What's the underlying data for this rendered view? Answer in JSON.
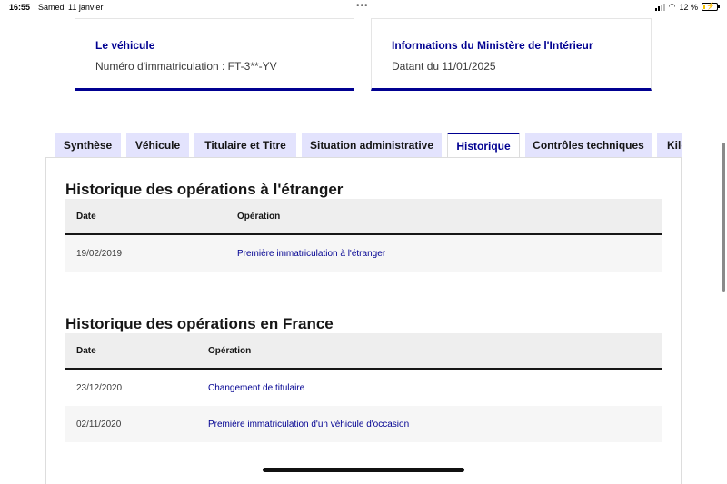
{
  "status_bar": {
    "time": "16:55",
    "date": "Samedi 11 janvier",
    "battery": "12 %",
    "battery_level": 0.12
  },
  "cards": [
    {
      "title": "Le véhicule",
      "text": "Numéro d'immatriculation : FT-3**-YV"
    },
    {
      "title": "Informations du Ministère de l'Intérieur",
      "text": "Datant du 11/01/2025"
    }
  ],
  "tabs": [
    {
      "label": "Synthèse"
    },
    {
      "label": "Véhicule"
    },
    {
      "label": "Titulaire et Titre"
    },
    {
      "label": "Situation administrative"
    },
    {
      "label": "Historique",
      "active": true
    },
    {
      "label": "Contrôles techniques"
    },
    {
      "label": "Kilo"
    }
  ],
  "sections": [
    {
      "title": "Historique des opérations à l'étranger",
      "headers": [
        "Date",
        "Opération"
      ],
      "rows": [
        {
          "date": "19/02/2019",
          "operation": "Première immatriculation à l'étranger"
        }
      ]
    },
    {
      "title": "Historique des opérations en France",
      "headers": [
        "Date",
        "Opération"
      ],
      "rows": [
        {
          "date": "23/12/2020",
          "operation": "Changement de titulaire"
        },
        {
          "date": "02/11/2020",
          "operation": "Première immatriculation d'un véhicule d'occasion"
        }
      ]
    }
  ],
  "colors": {
    "accent": "#000091",
    "tab_background": "#e3e3fd",
    "header_background": "#eeeeee",
    "battery_low": "#f5c400"
  }
}
